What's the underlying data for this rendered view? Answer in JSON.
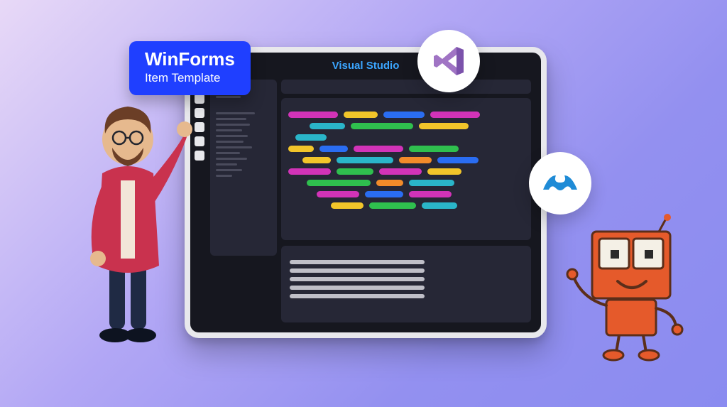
{
  "callout": {
    "title": "WinForms",
    "subtitle": "Item Template"
  },
  "ide": {
    "title": "Visual Studio"
  },
  "badges": {
    "vs": "visual-studio-logo",
    "net": "dotnet-logo"
  },
  "colors": {
    "accent_blue": "#1f3fff",
    "code_magenta": "#d233b8",
    "code_yellow": "#f2c52a",
    "code_cyan": "#2ab5c9",
    "code_blue": "#2a6df2",
    "code_green": "#2fbf4e",
    "code_orange": "#f28b2a"
  }
}
